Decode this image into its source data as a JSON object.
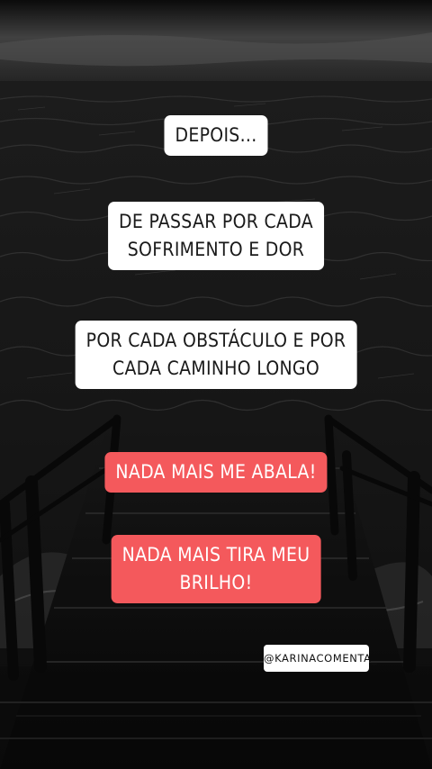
{
  "captions": [
    {
      "lines": [
        "DEPOIS..."
      ]
    },
    {
      "lines": [
        "DE PASSAR POR CADA",
        "SOFRIMENTO E DOR"
      ]
    },
    {
      "lines": [
        "POR CADA OBSTÁCULO E POR",
        "CADA CAMINHO LONGO"
      ]
    },
    {
      "lines": [
        "NADA MAIS ME ABALA!"
      ]
    },
    {
      "lines": [
        "NADA MAIS TIRA MEU",
        "BRILHO!"
      ]
    }
  ],
  "handle": "@KARINACOMENTA_",
  "colors": {
    "caption_white_bg": "#ffffff",
    "caption_red_bg": "#f4595c",
    "scene": "#1c1c1c"
  },
  "scene_elements": [
    "dark-sky",
    "sea-waves",
    "pier-stairs",
    "railings"
  ]
}
